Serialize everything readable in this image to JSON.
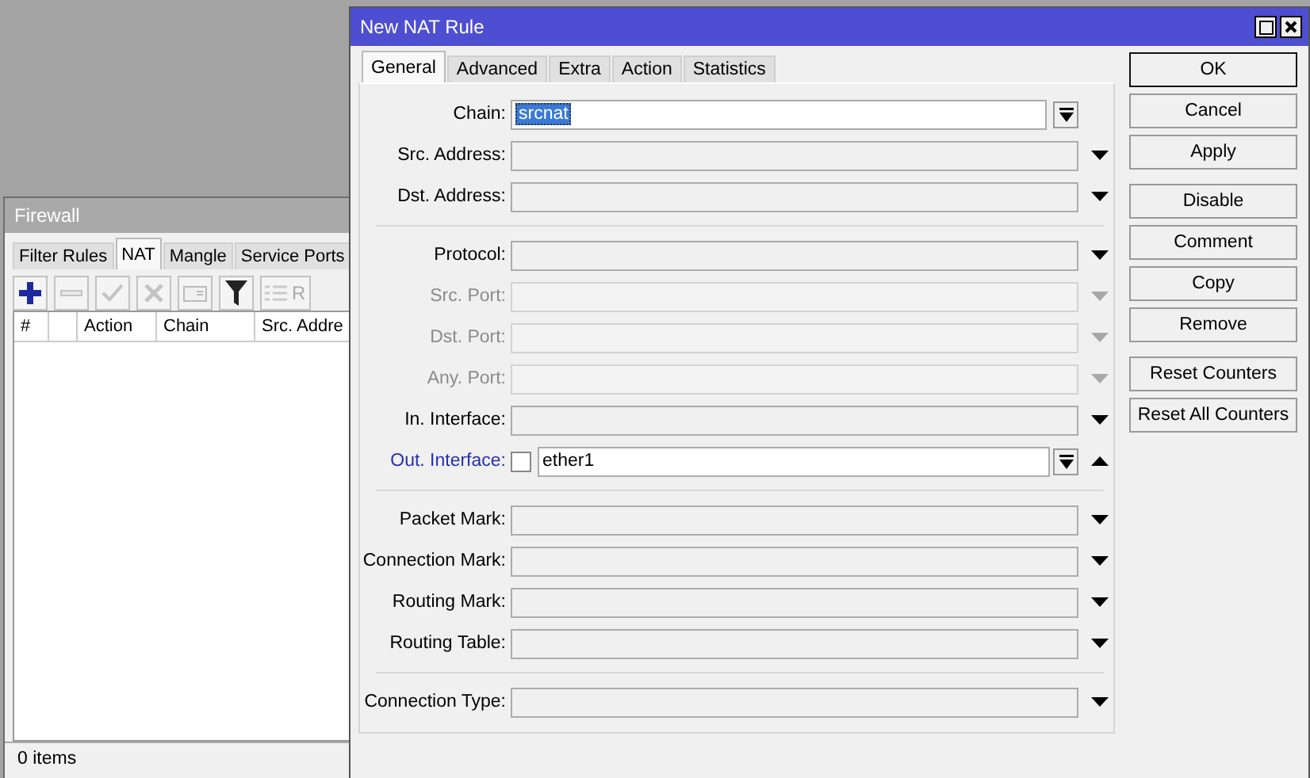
{
  "firewall": {
    "title": "Firewall",
    "tabs": [
      {
        "label": "Filter Rules",
        "selected": false
      },
      {
        "label": "NAT",
        "selected": true
      },
      {
        "label": "Mangle",
        "selected": false
      },
      {
        "label": "Service Ports",
        "selected": false
      }
    ],
    "toolbar": [
      {
        "kind": "add",
        "disabled": false
      },
      {
        "kind": "remove",
        "disabled": true
      },
      {
        "kind": "enable",
        "disabled": true
      },
      {
        "kind": "disable",
        "disabled": true
      },
      {
        "kind": "comment",
        "disabled": true
      },
      {
        "kind": "filter",
        "disabled": false
      },
      {
        "kind": "list",
        "label": "R",
        "disabled": true
      }
    ],
    "columns": [
      {
        "kind": "text",
        "label": "#"
      },
      {
        "kind": "blank"
      },
      {
        "kind": "text",
        "label": "Action"
      },
      {
        "kind": "text",
        "label": "Chain"
      },
      {
        "kind": "text",
        "label": "Src. Addre"
      }
    ],
    "status_bar": "0 items"
  },
  "dialog": {
    "title": "New NAT Rule",
    "tabs": [
      {
        "label": "General",
        "selected": true
      },
      {
        "label": "Advanced",
        "selected": false
      },
      {
        "label": "Extra",
        "selected": false
      },
      {
        "label": "Action",
        "selected": false
      },
      {
        "label": "Statistics",
        "selected": false
      }
    ],
    "sections": [
      [
        {
          "label": "Chain:",
          "kind": "select",
          "disabled": false,
          "value": "srcnat",
          "highlighted": true
        },
        {
          "label": "Src. Address:",
          "kind": "combo",
          "disabled": false
        },
        {
          "label": "Dst. Address:",
          "kind": "combo",
          "disabled": false
        }
      ],
      [
        {
          "label": "Protocol:",
          "kind": "combo",
          "disabled": false
        },
        {
          "label": "Src. Port:",
          "kind": "combo",
          "disabled": true
        },
        {
          "label": "Dst. Port:",
          "kind": "combo",
          "disabled": true
        },
        {
          "label": "Any. Port:",
          "kind": "combo",
          "disabled": true
        },
        {
          "label": "In. Interface:",
          "kind": "combo",
          "disabled": false
        },
        {
          "label": "Out. Interface:",
          "kind": "negatable",
          "disabled": false,
          "value": "ether1",
          "checked": false,
          "expanded": true
        }
      ],
      [
        {
          "label": "Packet Mark:",
          "kind": "combo",
          "disabled": false
        },
        {
          "label": "Connection Mark:",
          "kind": "combo",
          "disabled": false
        },
        {
          "label": "Routing Mark:",
          "kind": "combo",
          "disabled": false
        },
        {
          "label": "Routing Table:",
          "kind": "combo",
          "disabled": false
        }
      ],
      [
        {
          "label": "Connection Type:",
          "kind": "combo",
          "disabled": false
        }
      ]
    ],
    "buttons": [
      [
        {
          "label": "OK",
          "default": true
        },
        {
          "label": "Cancel",
          "default": false
        },
        {
          "label": "Apply",
          "default": false
        }
      ],
      [
        {
          "label": "Disable",
          "default": false
        },
        {
          "label": "Comment",
          "default": false
        },
        {
          "label": "Copy",
          "default": false
        },
        {
          "label": "Remove",
          "default": false
        }
      ],
      [
        {
          "label": "Reset Counters",
          "default": false
        },
        {
          "label": "Reset All Counters",
          "default": false
        }
      ]
    ]
  }
}
